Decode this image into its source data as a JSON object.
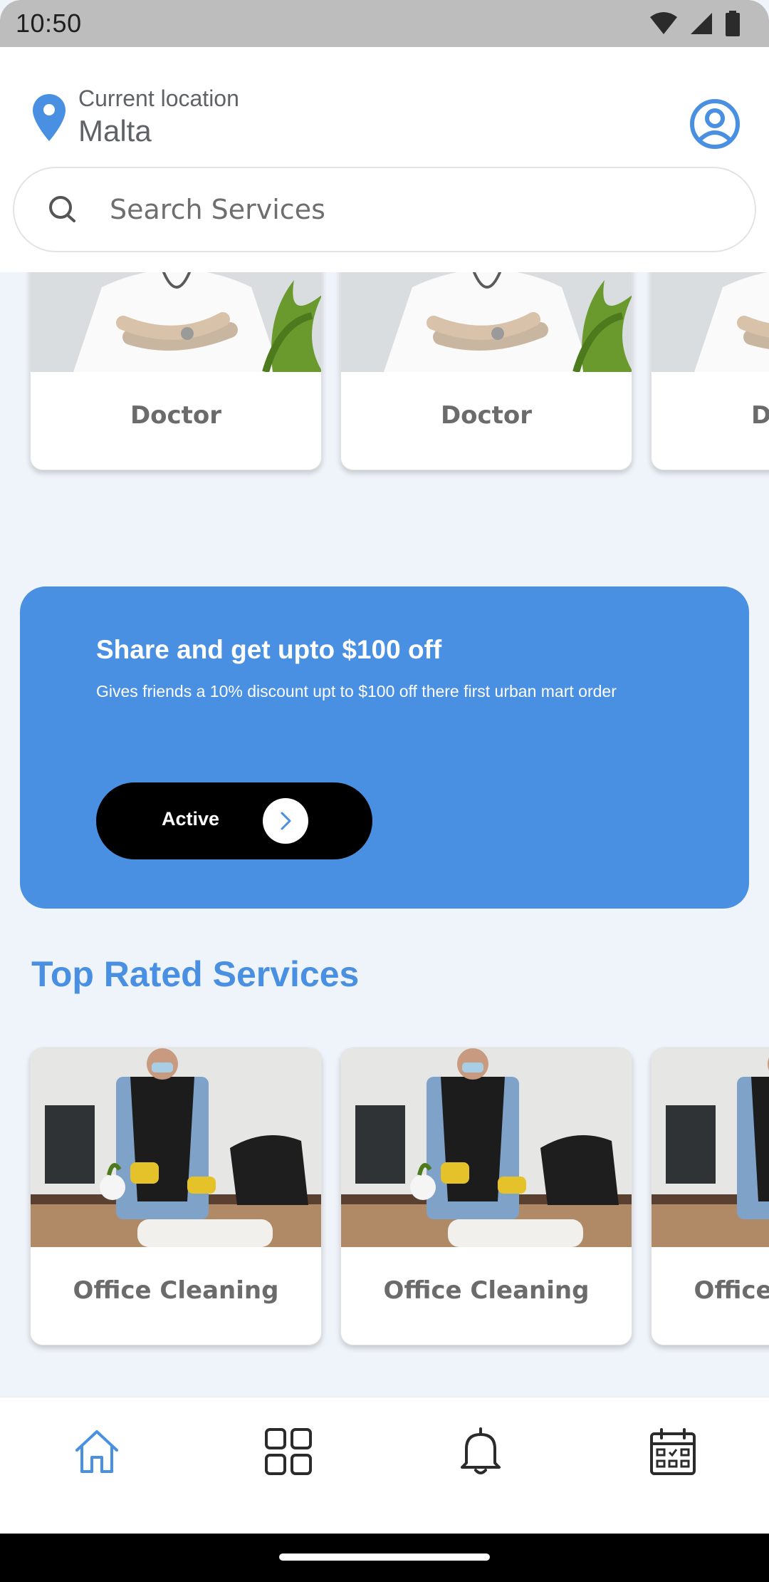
{
  "status_bar": {
    "time": "10:50"
  },
  "header": {
    "location_label": "Current location",
    "location_value": "Malta",
    "search_placeholder": "Search Services"
  },
  "categories": [
    {
      "label": "Doctor"
    },
    {
      "label": "Doctor"
    },
    {
      "label": "Doctor"
    }
  ],
  "promo": {
    "title": "Share and get upto $100 off",
    "description": "Gives friends a 10% discount upt to $100 off there first urban mart order",
    "button_label": "Active"
  },
  "top_rated": {
    "title": "Top Rated Services",
    "items": [
      {
        "label": "Office Cleaning"
      },
      {
        "label": "Office Cleaning"
      },
      {
        "label": "Office Cleaning"
      }
    ]
  },
  "bottom_nav": {
    "items": [
      {
        "icon": "home-icon",
        "active": true
      },
      {
        "icon": "grid-icon",
        "active": false
      },
      {
        "icon": "bell-icon",
        "active": false
      },
      {
        "icon": "calendar-icon",
        "active": false
      }
    ]
  },
  "colors": {
    "accent": "#4A90E2",
    "background": "#EFF4FA",
    "text_muted": "#6B6B6B"
  }
}
